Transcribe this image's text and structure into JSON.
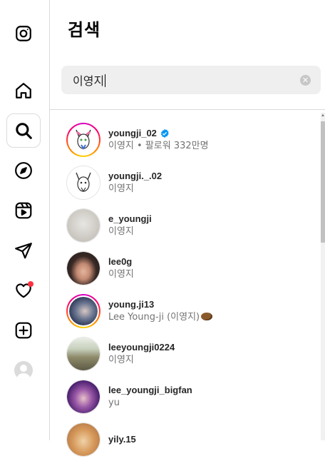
{
  "panel": {
    "title": "검색"
  },
  "search": {
    "value": "이영지",
    "clear_icon": "clear-icon"
  },
  "nav": {
    "items": [
      {
        "name": "instagram-logo-icon"
      },
      {
        "name": "home-icon"
      },
      {
        "name": "search-icon",
        "active": true
      },
      {
        "name": "explore-icon"
      },
      {
        "name": "reels-icon"
      },
      {
        "name": "messages-icon"
      },
      {
        "name": "notifications-icon",
        "badge": true
      },
      {
        "name": "create-icon"
      },
      {
        "name": "profile-icon"
      }
    ]
  },
  "results": [
    {
      "username": "youngji_02",
      "subtitle": "이영지 • 팔로워 332만명",
      "verified": true,
      "ring": true,
      "avatar": "sketch-face"
    },
    {
      "username": "youngji._.02",
      "subtitle": "이영지",
      "verified": false,
      "ring": false,
      "avatar": "sketch-face"
    },
    {
      "username": "e_youngji",
      "subtitle": "이영지",
      "verified": false,
      "ring": false,
      "avatar": "grey-photo"
    },
    {
      "username": "lee0g",
      "subtitle": "이영지",
      "verified": false,
      "ring": false,
      "avatar": "portrait-dark"
    },
    {
      "username": "young.ji13",
      "subtitle": "Lee Young-ji (이영지)",
      "verified": false,
      "ring": true,
      "avatar": "portrait-blue",
      "emoji": "potato"
    },
    {
      "username": "leeyoungji0224",
      "subtitle": "이영지",
      "verified": false,
      "ring": false,
      "avatar": "outdoor-photo"
    },
    {
      "username": "lee_youngji_bigfan",
      "subtitle": "yu",
      "verified": false,
      "ring": false,
      "avatar": "portrait-purple"
    },
    {
      "username": "yily.15",
      "subtitle": "",
      "verified": false,
      "ring": false,
      "avatar": "cat-photo"
    }
  ],
  "colors": {
    "verified": "#0095f6",
    "notification_dot": "#ff3040",
    "subtext": "#737373",
    "search_bg": "#efefef"
  }
}
